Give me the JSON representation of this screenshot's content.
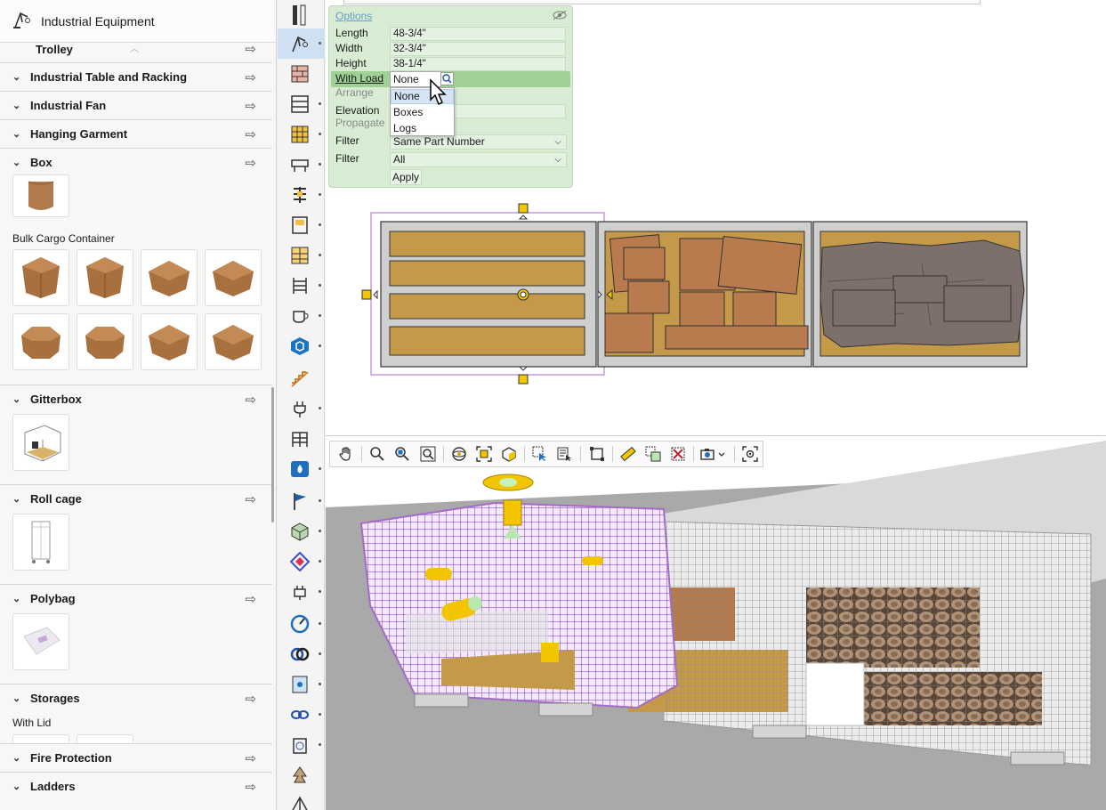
{
  "library": {
    "title": "Industrial Equipment",
    "categories": [
      {
        "label": "Trolley"
      },
      {
        "label": "Industrial Table and Racking"
      },
      {
        "label": "Industrial Fan"
      },
      {
        "label": "Hanging Garment"
      },
      {
        "label": "Box"
      },
      {
        "label": "Gitterbox"
      },
      {
        "label": "Roll cage"
      },
      {
        "label": "Polybag"
      },
      {
        "label": "Storages"
      },
      {
        "label": "Fire Protection"
      },
      {
        "label": "Ladders"
      }
    ],
    "sublabels": {
      "bulk": "Bulk Cargo Container",
      "withlid": "With Lid"
    }
  },
  "options": {
    "header": "Options",
    "length_label": "Length",
    "length_value": "48-3/4\"",
    "width_label": "Width",
    "width_value": "32-3/4\"",
    "height_label": "Height",
    "height_value": "38-1/4\"",
    "withload_label": "With Load",
    "withload_value": "None",
    "arrange_label": "Arrange",
    "elevation_label": "Elevation",
    "propagate_label": "Propagate",
    "filter1_label": "Filter",
    "filter1_value": "Same Part Number",
    "filter2_label": "Filter",
    "filter2_value": "All",
    "apply_label": "Apply",
    "dropdown": [
      "None",
      "Boxes",
      "Logs"
    ]
  },
  "colors": {
    "accent": "#9fd196",
    "selection": "#a46bc9",
    "cargo": "#c49a4a",
    "box": "#b97a4e",
    "log": "#7d6f6c",
    "handle": "#f2c500"
  }
}
